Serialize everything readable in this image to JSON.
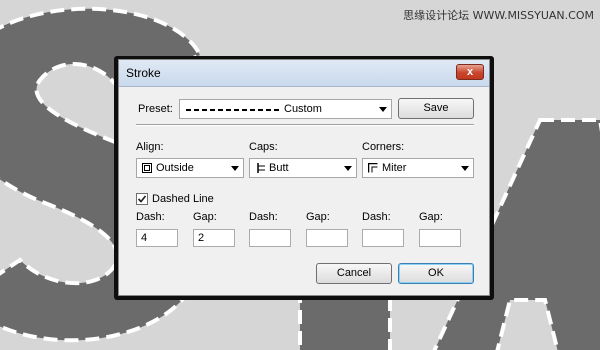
{
  "watermark": "思缘设计论坛 WWW.MISSYUAN.COM",
  "dialog": {
    "title": "Stroke",
    "close_glyph": "x",
    "preset_label": "Preset:",
    "preset_value": "Custom",
    "save_label": "Save",
    "align_label": "Align:",
    "align_value": "Outside",
    "caps_label": "Caps:",
    "caps_value": "Butt",
    "corners_label": "Corners:",
    "corners_value": "Miter",
    "dashed_label": "Dashed Line",
    "dashed_checked": true,
    "dash_gap_labels": [
      "Dash:",
      "Gap:",
      "Dash:",
      "Gap:",
      "Dash:",
      "Gap:"
    ],
    "dash_gap_values": [
      "4",
      "2",
      "",
      "",
      "",
      ""
    ],
    "cancel_label": "Cancel",
    "ok_label": "OK"
  },
  "colors": {
    "canvas_bg": "#d6d6d6",
    "shape_fill": "#6b6b6b",
    "stroke_dash": "#ffffff",
    "close_button": "#c8462d"
  }
}
